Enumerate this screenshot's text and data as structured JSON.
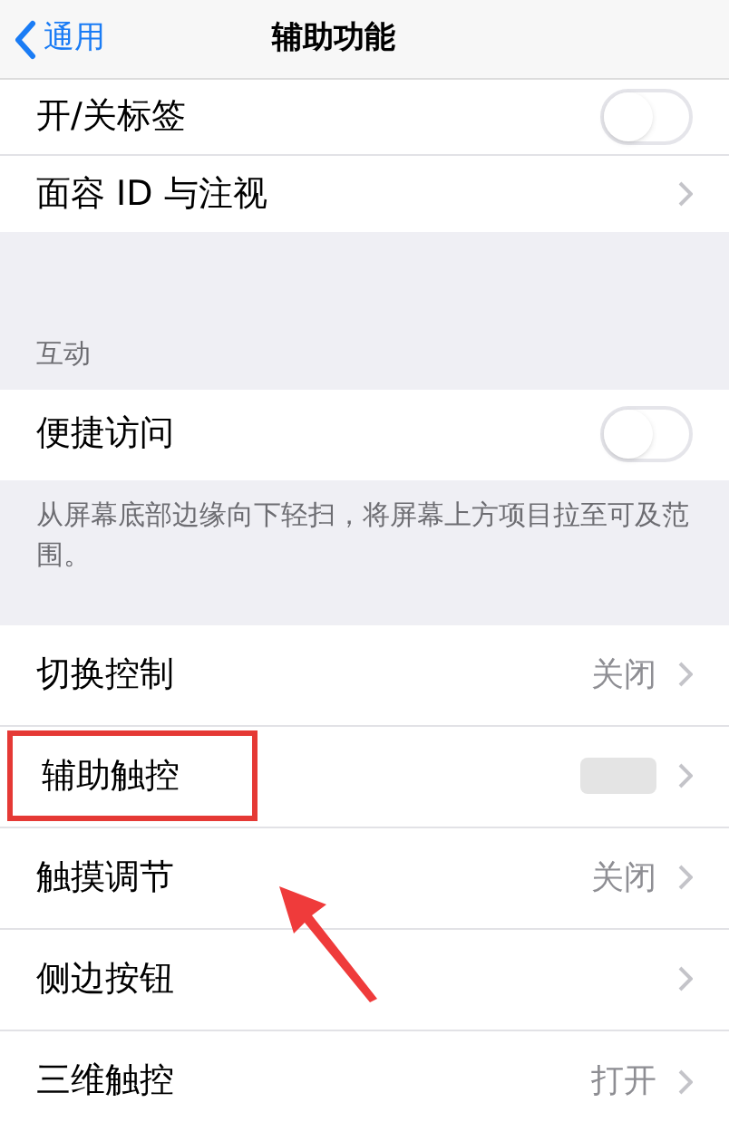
{
  "nav": {
    "back": "通用",
    "title": "辅助功能"
  },
  "group_1": [
    {
      "kind": "toggle",
      "label": "开/关标签",
      "on": false
    },
    {
      "kind": "link",
      "label": "面容 ID 与注视"
    }
  ],
  "section_2": {
    "header": "互动",
    "rows": [
      {
        "kind": "toggle",
        "label": "便捷访问",
        "on": false
      }
    ],
    "footer": "从屏幕底部边缘向下轻扫，将屏幕上方项目拉至可及范围。"
  },
  "group_3": [
    {
      "kind": "link",
      "label": "切换控制",
      "value": "关闭"
    },
    {
      "kind": "redacted",
      "label": "辅助触控",
      "highlighted": true
    },
    {
      "kind": "link",
      "label": "触摸调节",
      "value": "关闭"
    },
    {
      "kind": "link",
      "label": "侧边按钮"
    },
    {
      "kind": "link",
      "label": "三维触控",
      "value": "打开"
    }
  ]
}
